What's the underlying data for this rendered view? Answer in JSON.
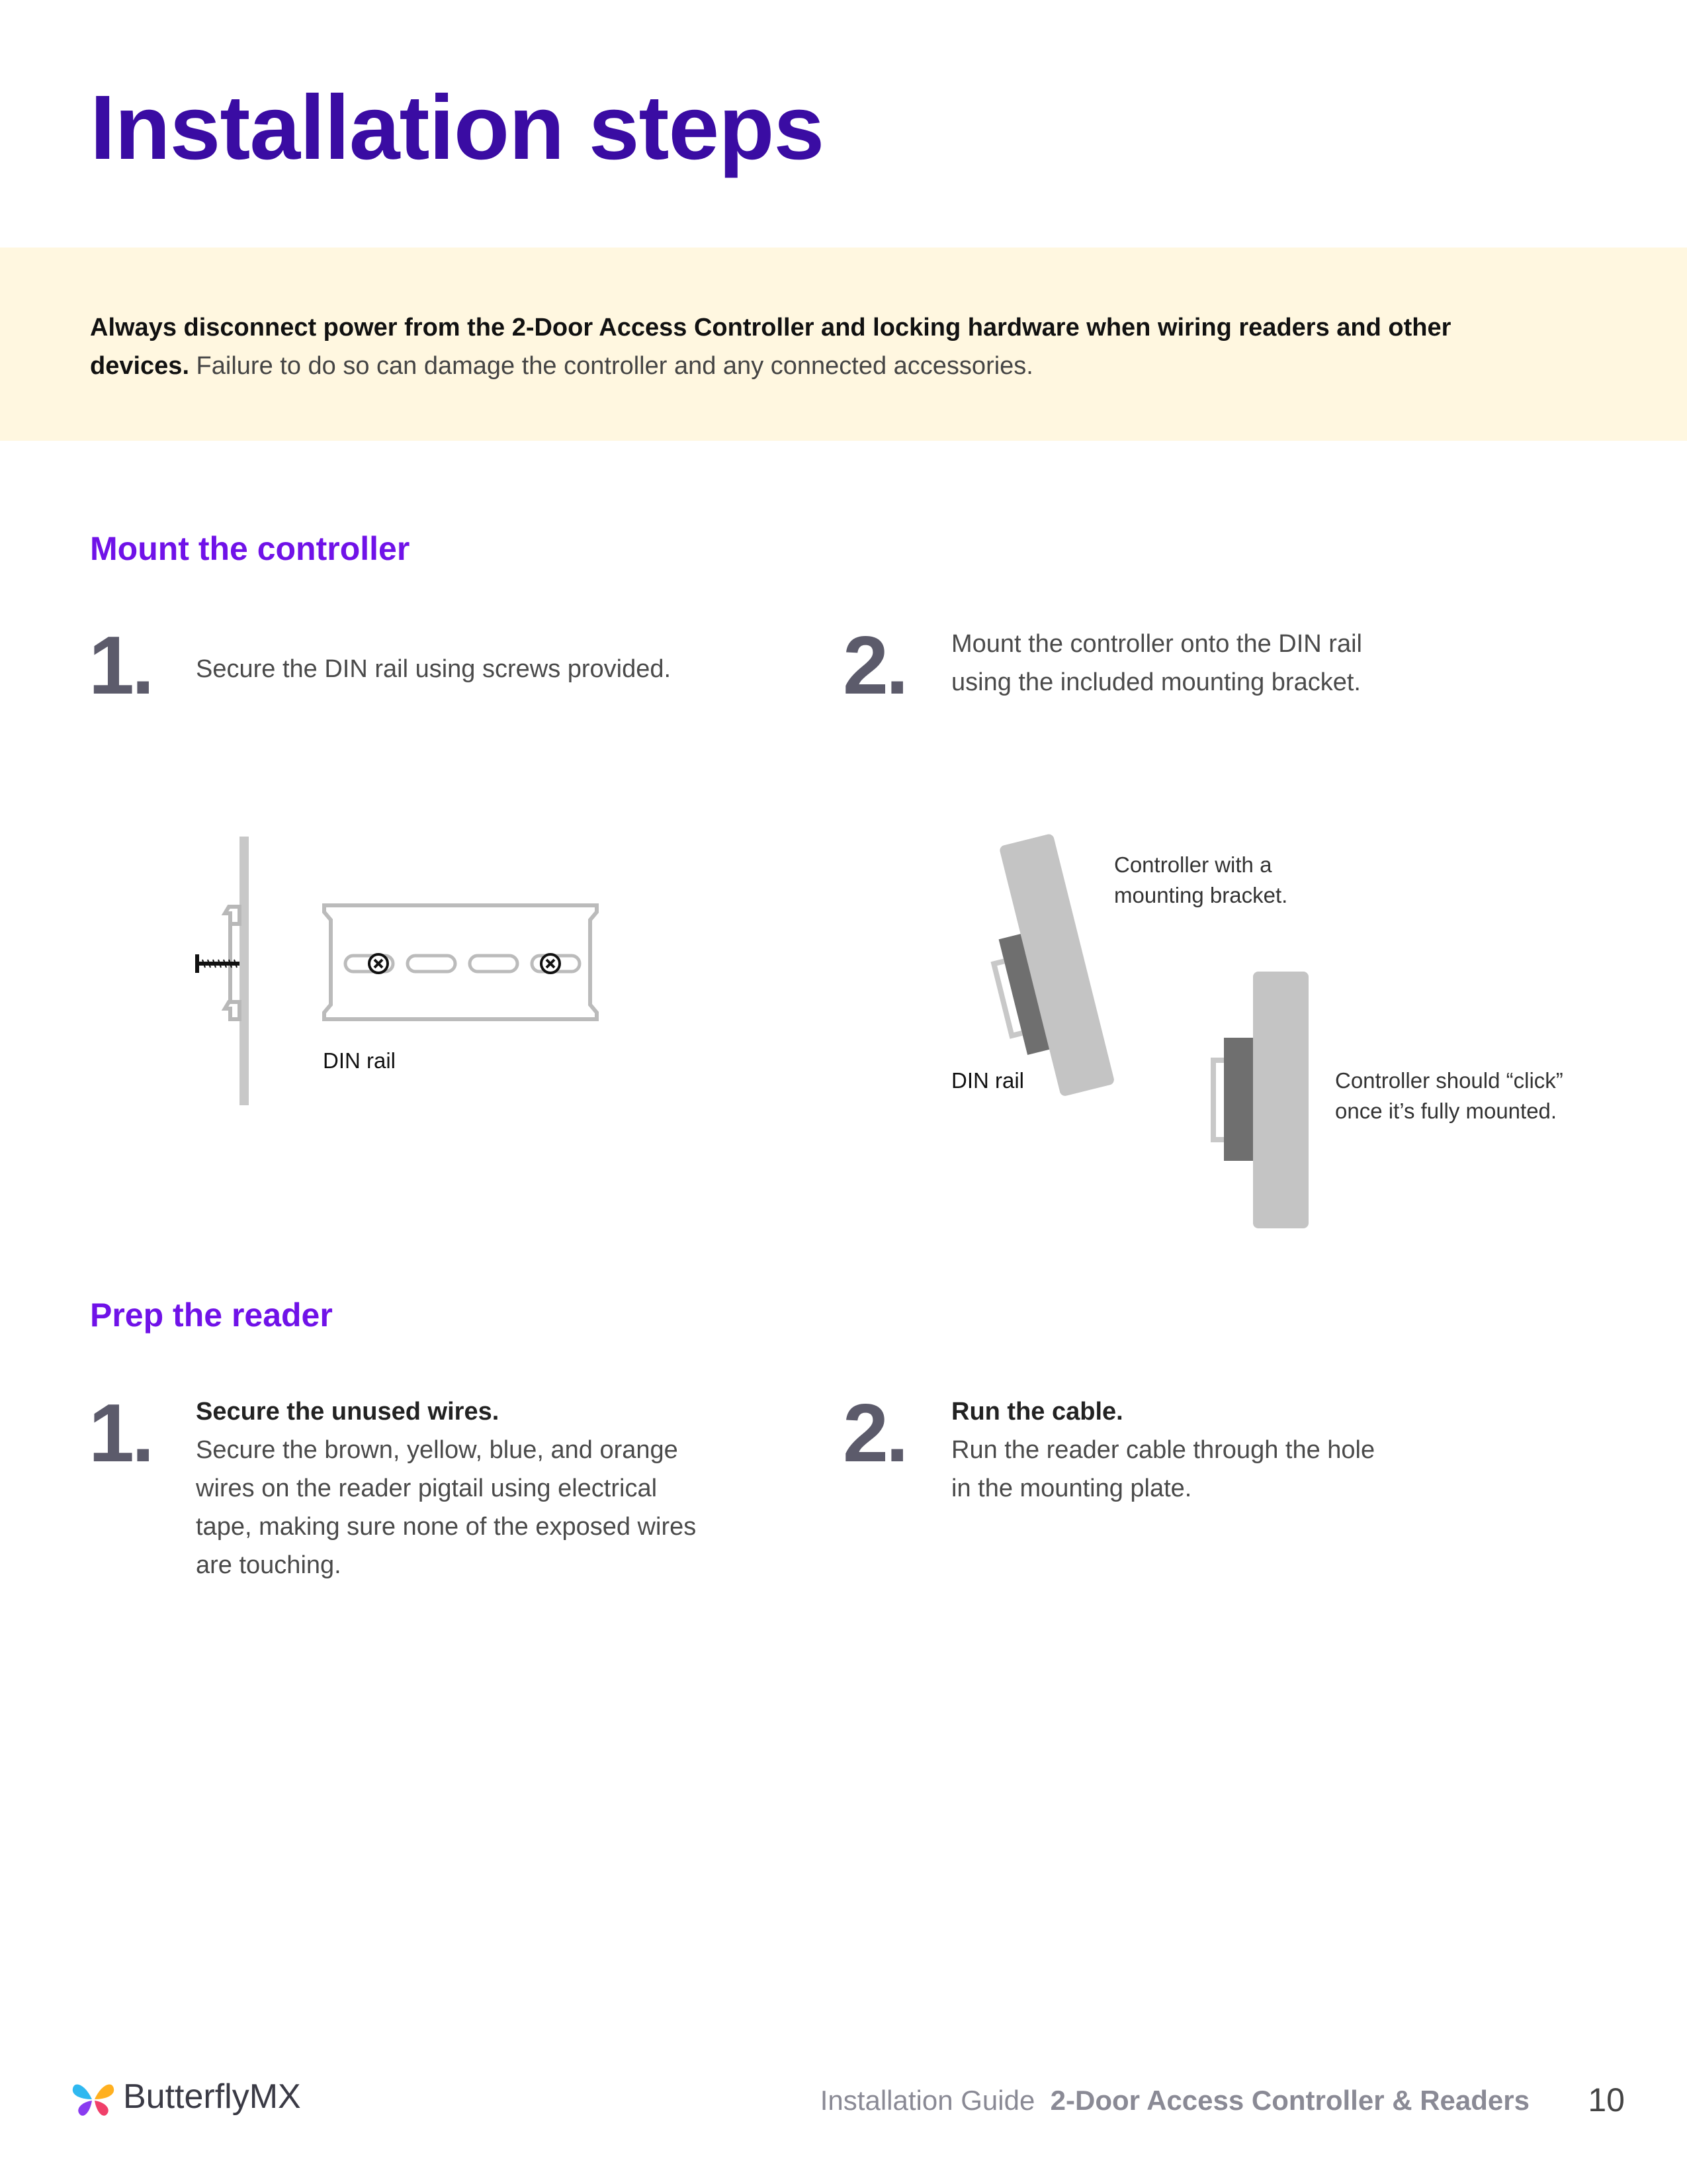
{
  "page": {
    "title": "Installation steps",
    "warning": {
      "bold": "Always disconnect power from the 2-Door Access Controller and locking hardware when wiring readers and other devices.",
      "normal": " Failure to do so can damage the controller and any connected accessories."
    }
  },
  "mount": {
    "heading": "Mount the controller",
    "step1": {
      "num": "1.",
      "text": "Secure the DIN rail using screws provided."
    },
    "step2": {
      "num": "2.",
      "text_line1": "Mount the controller onto the DIN rail",
      "text_line2": "using the included mounting bracket."
    },
    "fig1": {
      "rail_label": "DIN rail"
    },
    "fig2": {
      "rail_label": "DIN rail",
      "bracket_line1": "Controller with a",
      "bracket_line2": "mounting bracket.",
      "click_line1": "Controller should “click”",
      "click_line2": "once it’s fully mounted."
    }
  },
  "prep": {
    "heading": "Prep the reader",
    "step1": {
      "num": "1.",
      "title": "Secure the unused wires.",
      "lines": [
        "Secure the brown, yellow, blue, and orange",
        "wires on the reader pigtail using electrical",
        "tape, making sure none of the exposed wires",
        "are touching."
      ]
    },
    "step2": {
      "num": "2.",
      "title": "Run the cable.",
      "lines": [
        "Run the reader cable through the hole",
        "in the mounting plate."
      ]
    }
  },
  "footer": {
    "logo": "ButterflyMX",
    "guide": "Installation Guide",
    "product": "2-Door Access Controller & Readers",
    "page_number": "10"
  },
  "colors": {
    "title": "#3a0ca3",
    "heading": "#7012e8",
    "warning_bg": "#fff7e0",
    "step_number": "#5c5b6b"
  },
  "icons": [
    "butterfly-logo-icon",
    "screw-icon"
  ]
}
